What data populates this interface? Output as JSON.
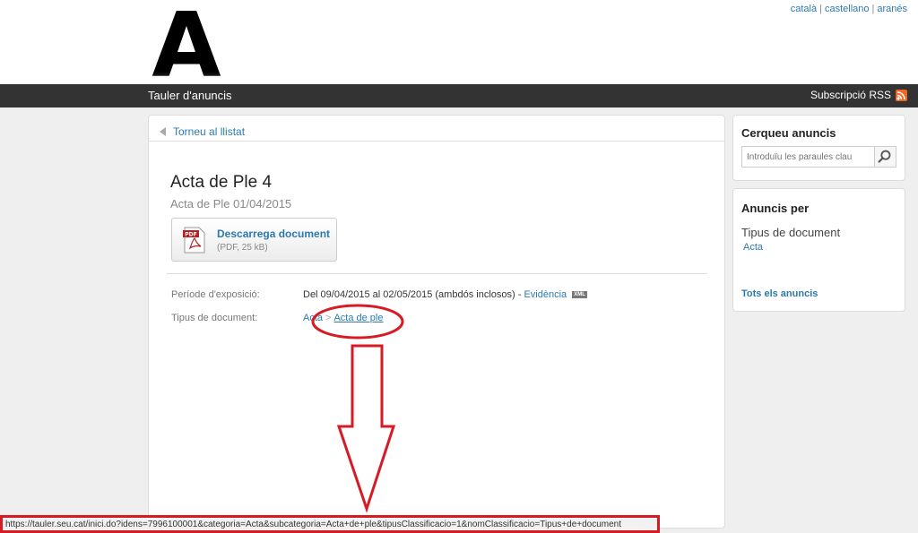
{
  "header": {
    "logo_letter": "A",
    "languages": [
      "català",
      "castellano",
      "aranés"
    ],
    "bar_title": "Tauler d'anuncis",
    "rss_label": "Subscripció RSS"
  },
  "main": {
    "back_label": "Torneu al llistat",
    "title": "Acta de Ple 4",
    "subtitle": "Acta de Ple 01/04/2015",
    "download": {
      "label": "Descarrega document",
      "info": "(PDF, 25 kB)",
      "icon_text": "PDF"
    },
    "exposure_label": "Període d'exposició:",
    "exposure_value": "Del 09/04/2015 al 02/05/2015 (ambdós inclosos) -",
    "evidence_link": "Evidència",
    "xml_badge": "XML",
    "doctype_label": "Tipus de document:",
    "doctype_crumb_1": "Acta",
    "doctype_crumb_sep": ">",
    "doctype_crumb_2": "Acta de ple"
  },
  "sidebar": {
    "search_title": "Cerqueu anuncis",
    "search_placeholder": "Introduïu les paraules clau",
    "by_title": "Anuncis per",
    "doc_type_label": "Tipus de document",
    "doc_type_link": "Acta",
    "all_link": "Tots els anuncis"
  },
  "status_bar": {
    "url": "https://tauler.seu.cat/inici.do?idens=7996100001&categoria=Acta&subcategoria=Acta+de+ple&tipusClassificacio=1&nomClassificacio=Tipus+de+document"
  },
  "colors": {
    "link": "#2a7ab0",
    "bar": "#333333",
    "annotation": "#d61b24",
    "rss": "#f26522"
  }
}
